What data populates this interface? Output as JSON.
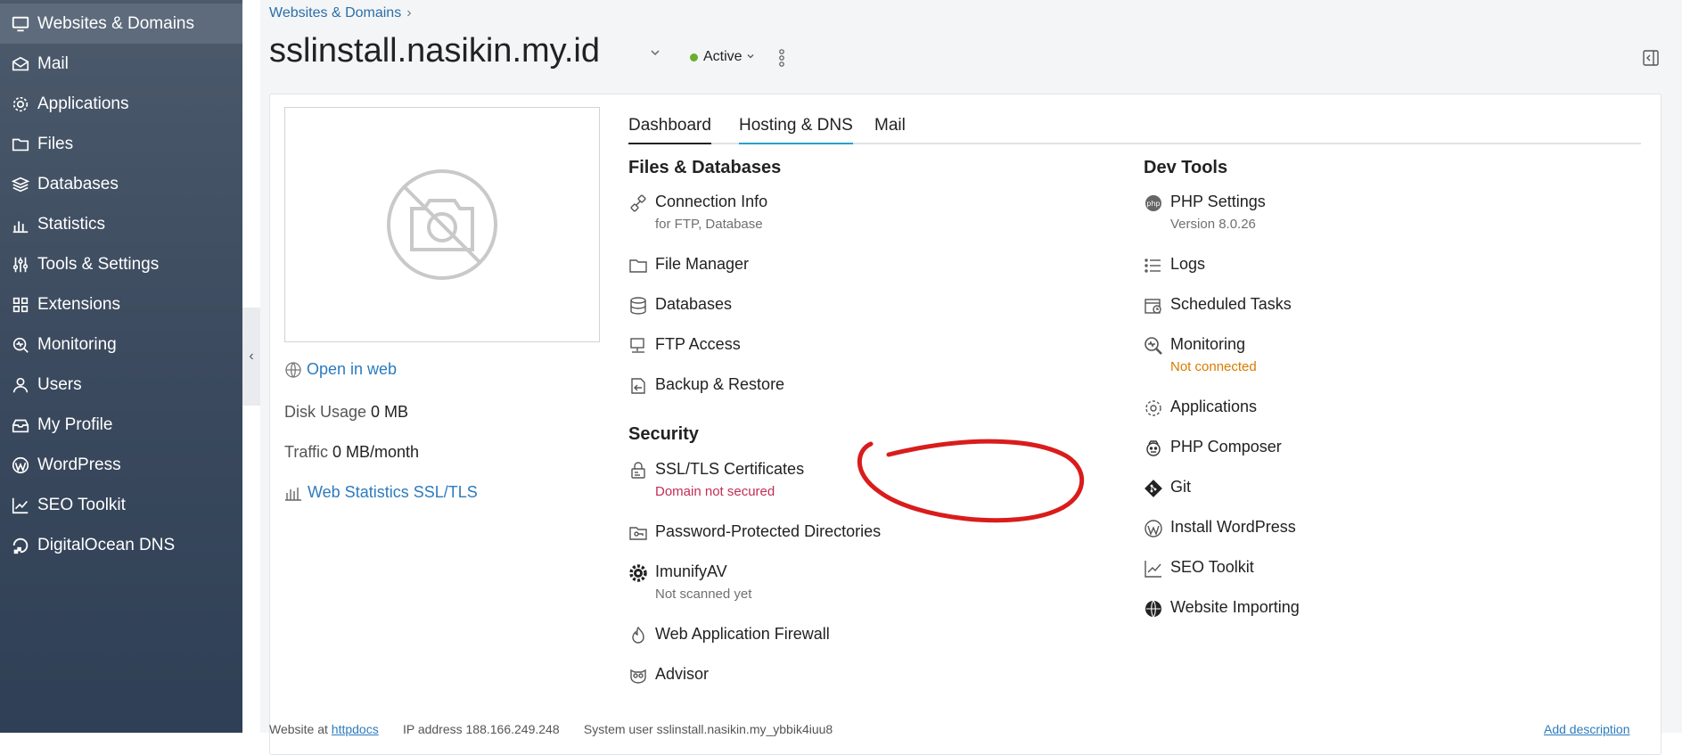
{
  "sidebar": {
    "items": [
      {
        "label": "Websites & Domains",
        "icon": "monitor-icon",
        "active": true
      },
      {
        "label": "Mail",
        "icon": "mail-icon"
      },
      {
        "label": "Applications",
        "icon": "gear-icon"
      },
      {
        "label": "Files",
        "icon": "folder-icon"
      },
      {
        "label": "Databases",
        "icon": "layers-icon"
      },
      {
        "label": "Statistics",
        "icon": "bar-chart-icon"
      },
      {
        "label": "Tools & Settings",
        "icon": "sliders-icon"
      },
      {
        "label": "Extensions",
        "icon": "grid-icon"
      },
      {
        "label": "Monitoring",
        "icon": "magnifier-pulse-icon"
      },
      {
        "label": "Users",
        "icon": "user-icon"
      },
      {
        "label": "My Profile",
        "icon": "profile-tray-icon"
      },
      {
        "label": "WordPress",
        "icon": "wordpress-icon"
      },
      {
        "label": "SEO Toolkit",
        "icon": "seo-chart-icon"
      },
      {
        "label": "DigitalOcean DNS",
        "icon": "digitalocean-icon"
      }
    ]
  },
  "header": {
    "breadcrumb": "Websites & Domains",
    "breadcrumb_sep": "›",
    "title": "sslinstall.nasikin.my.id",
    "status": "Active",
    "status_color": "#6aaf2d"
  },
  "left_panel": {
    "open_in_web": "Open in web",
    "disk_usage_label": "Disk Usage",
    "disk_usage_value": "0 MB",
    "traffic_label": "Traffic",
    "traffic_value": "0 MB/month",
    "web_stats": "Web Statistics SSL/TLS"
  },
  "tabs": [
    {
      "label": "Dashboard"
    },
    {
      "label": "Hosting & DNS"
    },
    {
      "label": "Mail"
    }
  ],
  "sections": {
    "files_db": {
      "title": "Files & Databases",
      "items": [
        {
          "label": "Connection Info",
          "sub": "for FTP, Database"
        },
        {
          "label": "File Manager"
        },
        {
          "label": "Databases"
        },
        {
          "label": "FTP Access"
        },
        {
          "label": "Backup & Restore"
        }
      ]
    },
    "security": {
      "title": "Security",
      "items": [
        {
          "label": "SSL/TLS Certificates",
          "sub": "Domain not secured"
        },
        {
          "label": "Password-Protected Directories"
        },
        {
          "label": "ImunifyAV",
          "sub": "Not scanned yet"
        },
        {
          "label": "Web Application Firewall"
        },
        {
          "label": "Advisor"
        }
      ]
    },
    "dev": {
      "title": "Dev Tools",
      "items": [
        {
          "label": "PHP Settings",
          "sub": "Version 8.0.26"
        },
        {
          "label": "Logs"
        },
        {
          "label": "Scheduled Tasks"
        },
        {
          "label": "Monitoring",
          "sub": "Not connected"
        },
        {
          "label": "Applications"
        },
        {
          "label": "PHP Composer"
        },
        {
          "label": "Git"
        },
        {
          "label": "Install WordPress"
        },
        {
          "label": "SEO Toolkit"
        },
        {
          "label": "Website Importing"
        }
      ]
    }
  },
  "footer": {
    "website_at": "Website at",
    "httpdocs": "httpdocs",
    "ip_label": "IP address",
    "ip_value": "188.166.249.248",
    "sys_user_label": "System user",
    "sys_user_value": "sslinstall.nasikin.my_ybbik4iuu8",
    "add_description": "Add description"
  },
  "colors": {
    "link": "#2b7bbf",
    "annotation": "#d91c1c",
    "error": "#c22d57",
    "warning": "#d97b00"
  }
}
